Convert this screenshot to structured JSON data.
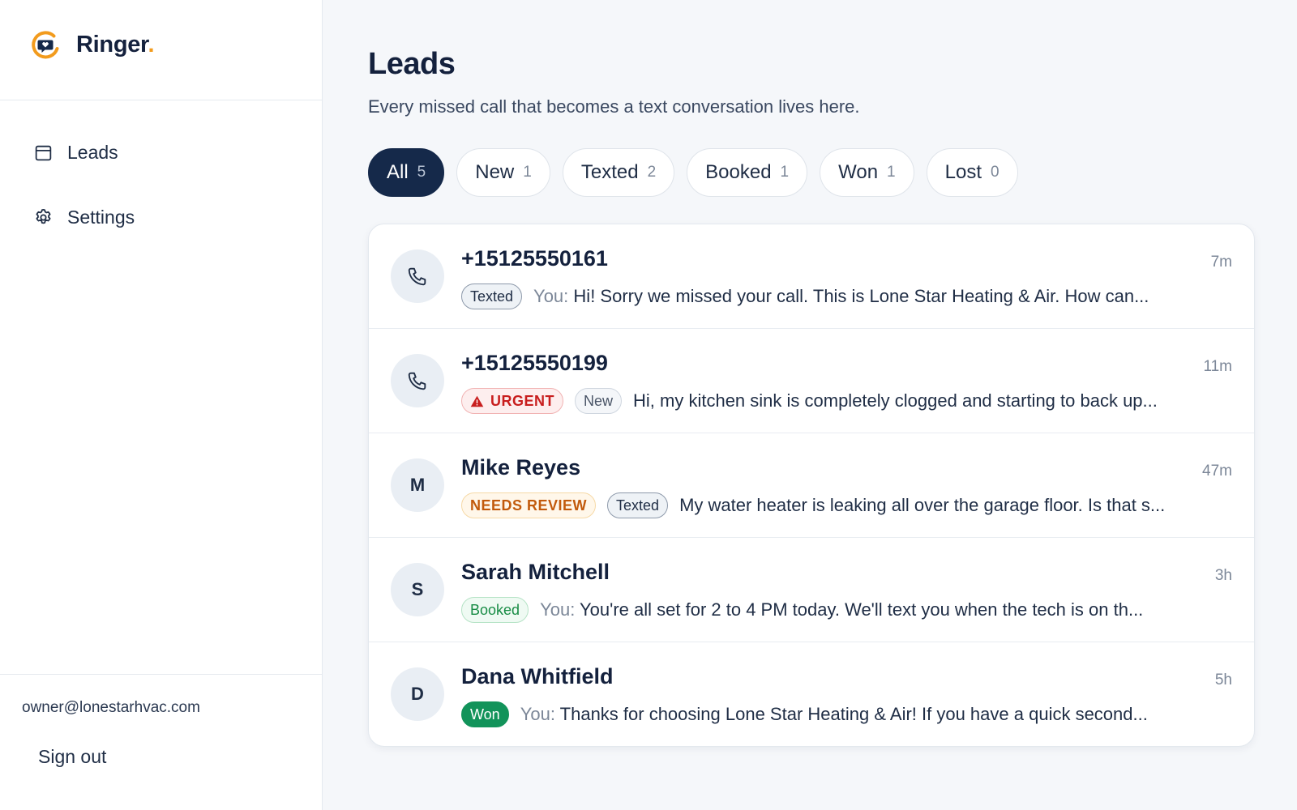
{
  "brand": {
    "name": "Ringer",
    "dot": ".",
    "accent_color": "#f29b1d",
    "logo_icon": "chat-bubble-heart-logo"
  },
  "sidebar": {
    "items": [
      {
        "label": "Leads",
        "icon": "inbox-icon"
      },
      {
        "label": "Settings",
        "icon": "gear-icon"
      }
    ],
    "user_email": "owner@lonestarhvac.com",
    "signout_label": "Sign out"
  },
  "page": {
    "title": "Leads",
    "subtitle": "Every missed call that becomes a text conversation lives here."
  },
  "filters": [
    {
      "label": "All",
      "count": "5",
      "active": true
    },
    {
      "label": "New",
      "count": "1"
    },
    {
      "label": "Texted",
      "count": "2"
    },
    {
      "label": "Booked",
      "count": "1"
    },
    {
      "label": "Won",
      "count": "1"
    },
    {
      "label": "Lost",
      "count": "0"
    }
  ],
  "leads": [
    {
      "name": "+15125550161",
      "avatar": "phone-icon",
      "time": "7m",
      "badges": [
        {
          "type": "texted",
          "label": "Texted"
        }
      ],
      "you_prefix": "You:",
      "preview": "Hi! Sorry we missed your call. This is Lone Star Heating & Air. How can..."
    },
    {
      "name": "+15125550199",
      "avatar": "phone-icon",
      "time": "11m",
      "badges": [
        {
          "type": "urgent",
          "label": "URGENT",
          "icon": "warning-icon"
        },
        {
          "type": "new",
          "label": "New"
        }
      ],
      "you_prefix": "",
      "preview": "Hi, my kitchen sink is completely clogged and starting to back up..."
    },
    {
      "name": "Mike Reyes",
      "avatar_initial": "M",
      "time": "47m",
      "badges": [
        {
          "type": "review",
          "label": "NEEDS REVIEW"
        },
        {
          "type": "texted",
          "label": "Texted"
        }
      ],
      "you_prefix": "",
      "preview": "My water heater is leaking all over the garage floor. Is that s..."
    },
    {
      "name": "Sarah Mitchell",
      "avatar_initial": "S",
      "time": "3h",
      "badges": [
        {
          "type": "booked",
          "label": "Booked"
        }
      ],
      "you_prefix": "You:",
      "preview": "You're all set for 2 to 4 PM today. We'll text you when the tech is on th..."
    },
    {
      "name": "Dana Whitfield",
      "avatar_initial": "D",
      "time": "5h",
      "badges": [
        {
          "type": "won",
          "label": "Won"
        }
      ],
      "you_prefix": "You:",
      "preview": "Thanks for choosing Lone Star Heating & Air! If you have a quick second..."
    }
  ]
}
